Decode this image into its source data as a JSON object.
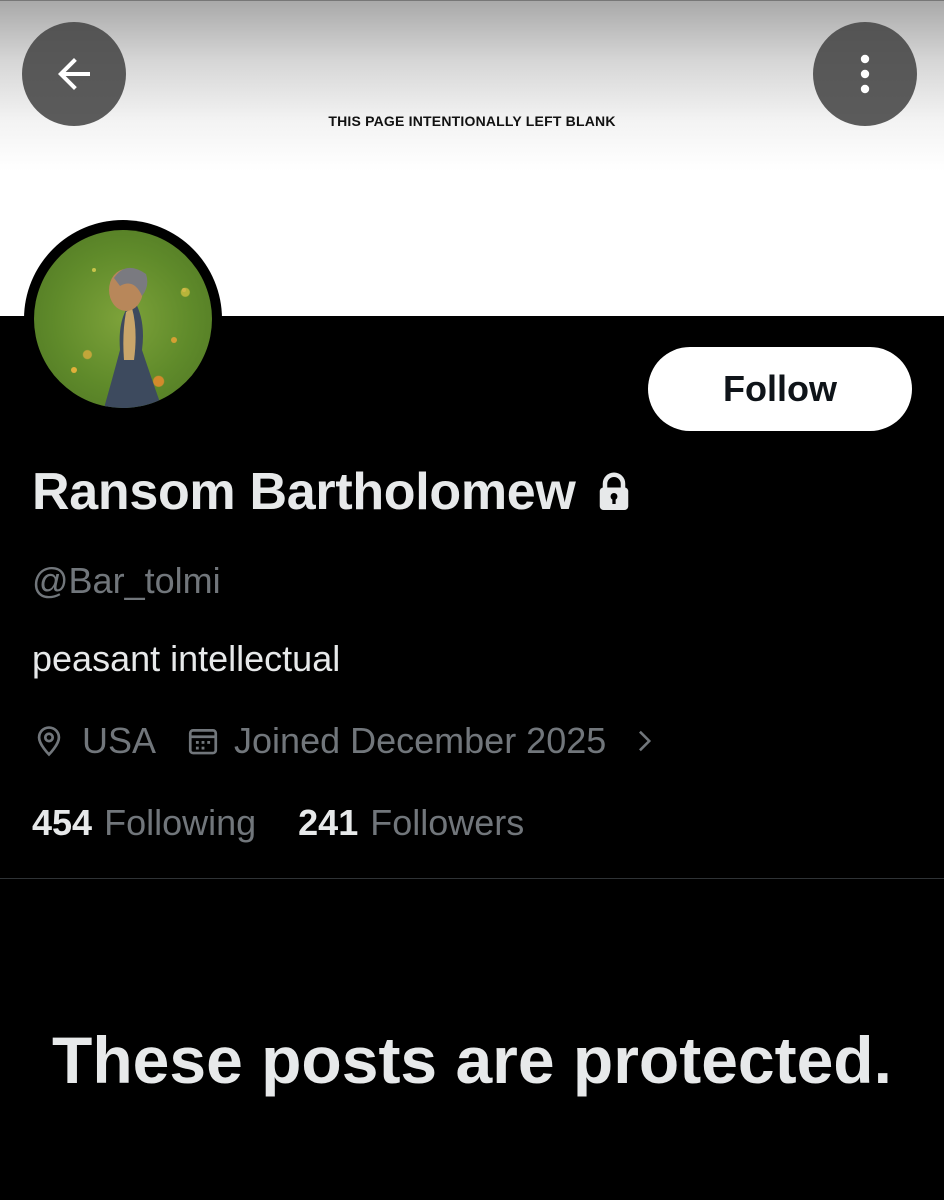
{
  "banner": {
    "text": "THIS PAGE INTENTIONALLY LEFT BLANK"
  },
  "header": {
    "back_icon": "arrow-left-icon",
    "more_icon": "vertical-dots-icon"
  },
  "profile": {
    "name": "Ransom Bartholomew",
    "handle": "@Bar_tolmi",
    "bio": "peasant intellectual",
    "location": "USA",
    "joined": "Joined December 2025",
    "follow_label": "Follow",
    "following_count": "454",
    "following_label": "Following",
    "followers_count": "241",
    "followers_label": "Followers",
    "protected_message": "These posts are protected."
  },
  "colors": {
    "background": "#000000",
    "primary_text": "#e7e9ea",
    "secondary_text": "#71767b",
    "button_bg": "#ffffff",
    "button_text": "#0f1419",
    "overlay_button": "#464646"
  }
}
